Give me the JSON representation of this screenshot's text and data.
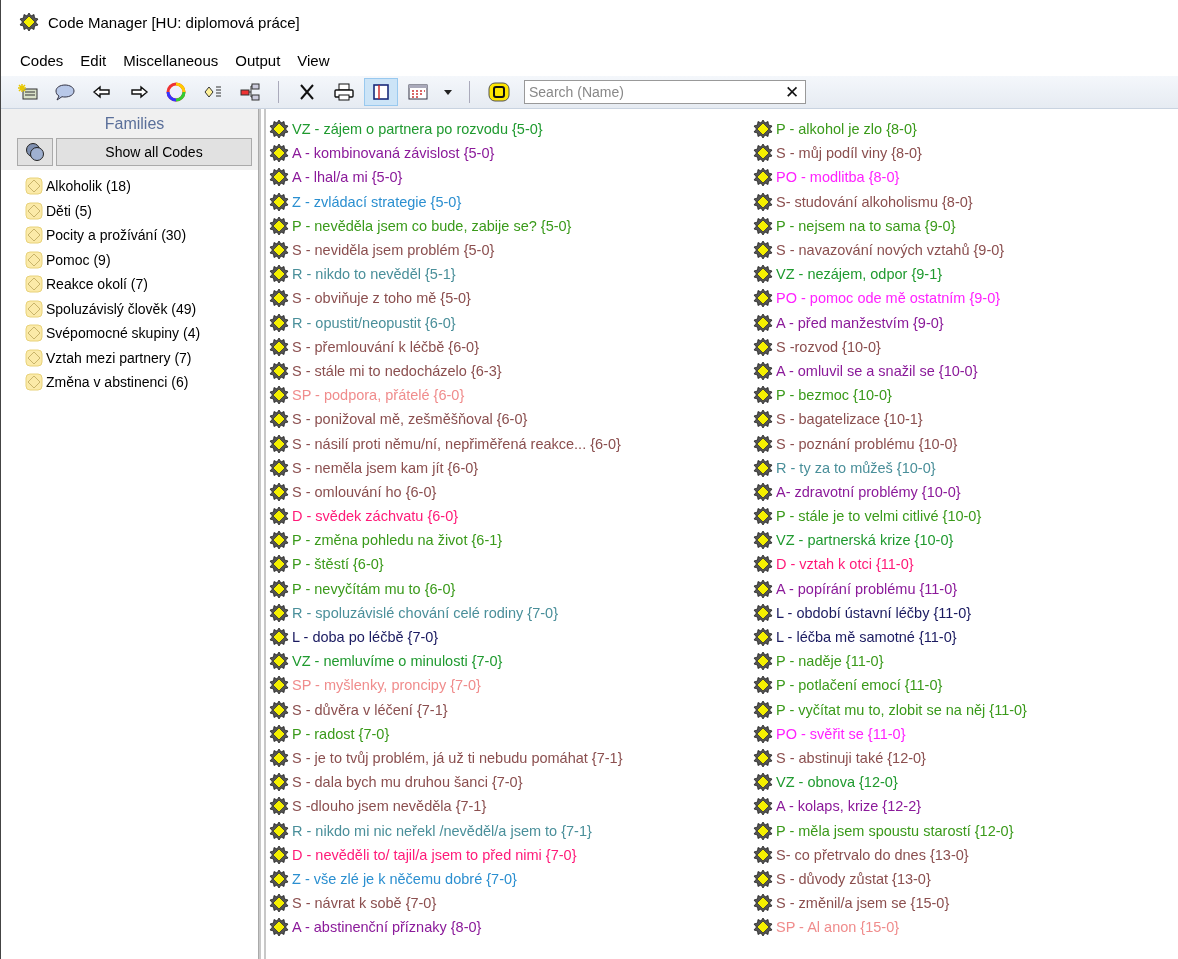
{
  "window": {
    "title": "Code Manager [HU: diplomová práce]"
  },
  "menu": [
    "Codes",
    "Edit",
    "Miscellaneous",
    "Output",
    "View"
  ],
  "toolbar": [
    {
      "kind": "new-code",
      "pressed": false
    },
    {
      "kind": "comment",
      "pressed": false
    },
    {
      "kind": "back",
      "pressed": false
    },
    {
      "kind": "forward",
      "pressed": false
    },
    {
      "kind": "colors",
      "pressed": false
    },
    {
      "kind": "list",
      "pressed": false
    },
    {
      "kind": "tree",
      "pressed": false
    },
    {
      "kind": "separator"
    },
    {
      "kind": "delete",
      "pressed": false
    },
    {
      "kind": "print",
      "pressed": false
    },
    {
      "kind": "split",
      "pressed": true
    },
    {
      "kind": "grid",
      "pressed": false
    },
    {
      "kind": "dropdown",
      "pressed": false
    },
    {
      "kind": "separator"
    },
    {
      "kind": "filter",
      "pressed": false
    }
  ],
  "search": {
    "placeholder": "Search (Name)",
    "clear": "✕"
  },
  "families": {
    "title": "Families",
    "show_all": "Show all Codes",
    "items": [
      "Alkoholik (18)",
      "Děti (5)",
      "Pocity a prožívání (30)",
      "Pomoc (9)",
      "Reakce okolí (7)",
      "Spoluzávislý člověk (49)",
      "Svépomocné skupiny (4)",
      "Vztah mezi partnery (7)",
      "Změna v abstinenci (6)"
    ]
  },
  "codes": [
    {
      "label": "VZ - zájem o partnera po rozvodu {5-0}",
      "color": "#1f9a2f"
    },
    {
      "label": "A - kombinovaná závislost {5-0}",
      "color": "#8b1a9a"
    },
    {
      "label": "A - lhal/a mi {5-0}",
      "color": "#8b1a9a"
    },
    {
      "label": "Z - zvládací strategie {5-0}",
      "color": "#2b8fd0"
    },
    {
      "label": "P - nevěděla jsem co bude, zabije se? {5-0}",
      "color": "#3a9a1a"
    },
    {
      "label": "S - neviděla jsem problém {5-0}",
      "color": "#8b4f4f"
    },
    {
      "label": "R - nikdo to nevěděl {5-1}",
      "color": "#4a8f9a"
    },
    {
      "label": "S - obviňuje z toho mě {5-0}",
      "color": "#8b4f4f"
    },
    {
      "label": "R - opustit/neopustit {6-0}",
      "color": "#4a8f9a"
    },
    {
      "label": "S - přemlouvání k léčbě {6-0}",
      "color": "#8b4f4f"
    },
    {
      "label": "S - stále mi to nedocházelo {6-3}",
      "color": "#8b4f4f"
    },
    {
      "label": "SP - podpora, přátelé {6-0}",
      "color": "#f08c8c"
    },
    {
      "label": "S - ponižoval mě, zešměšňoval {6-0}",
      "color": "#8b4f4f"
    },
    {
      "label": "S - násilí proti němu/ní, nepřiměřená reakce... {6-0}",
      "color": "#8b4f4f"
    },
    {
      "label": "S - neměla jsem kam jít {6-0}",
      "color": "#8b4f4f"
    },
    {
      "label": "S - omlouvání ho {6-0}",
      "color": "#8b4f4f"
    },
    {
      "label": "D - svědek záchvatu {6-0}",
      "color": "#ff1a78"
    },
    {
      "label": "P - změna pohledu na život {6-1}",
      "color": "#3a9a1a"
    },
    {
      "label": "P - štěstí {6-0}",
      "color": "#3a9a1a"
    },
    {
      "label": "P - nevyčítám mu to {6-0}",
      "color": "#3a9a1a"
    },
    {
      "label": "R - spoluzávislé chování celé rodiny {7-0}",
      "color": "#4a8f9a"
    },
    {
      "label": "L - doba po léčbě {7-0}",
      "color": "#1a1a60"
    },
    {
      "label": "VZ - nemluvíme o minulosti {7-0}",
      "color": "#1f9a2f"
    },
    {
      "label": "SP - myšlenky, proncipy {7-0}",
      "color": "#f08c8c"
    },
    {
      "label": "S - důvěra v léčení {7-1}",
      "color": "#8b4f4f"
    },
    {
      "label": "P - radost {7-0}",
      "color": "#3a9a1a"
    },
    {
      "label": "S - je to tvůj problém, já už ti nebudu pomáhat {7-1}",
      "color": "#8b4f4f"
    },
    {
      "label": "S - dala bych mu druhou šanci {7-0}",
      "color": "#8b4f4f"
    },
    {
      "label": "S -dlouho jsem nevěděla {7-1}",
      "color": "#8b4f4f"
    },
    {
      "label": "R - nikdo mi nic neřekl /nevěděl/a jsem to {7-1}",
      "color": "#4a8f9a"
    },
    {
      "label": "D - nevěděli to/ tajil/a jsem to před nimi {7-0}",
      "color": "#ff1a78"
    },
    {
      "label": "Z - vše zlé je k něčemu dobré {7-0}",
      "color": "#2b8fd0"
    },
    {
      "label": "S - návrat k sobě {7-0}",
      "color": "#8b4f4f"
    },
    {
      "label": "A - abstinenční příznaky {8-0}",
      "color": "#8b1a9a"
    },
    {
      "label": "P - alkohol je zlo {8-0}",
      "color": "#3a9a1a"
    },
    {
      "label": "S - můj podíl viny {8-0}",
      "color": "#8b4f4f"
    },
    {
      "label": "PO - modlitba {8-0}",
      "color": "#ff22ff"
    },
    {
      "label": "S- studování alkoholismu {8-0}",
      "color": "#8b4f4f"
    },
    {
      "label": "P - nejsem na to sama {9-0}",
      "color": "#3a9a1a"
    },
    {
      "label": "S - navazování nových vztahů {9-0}",
      "color": "#8b4f4f"
    },
    {
      "label": "VZ - nezájem, odpor {9-1}",
      "color": "#1f9a2f"
    },
    {
      "label": "PO - pomoc ode mě ostatním {9-0}",
      "color": "#ff22ff"
    },
    {
      "label": "A - před manžestvím {9-0}",
      "color": "#8b1a9a"
    },
    {
      "label": "S -rozvod {10-0}",
      "color": "#8b4f4f"
    },
    {
      "label": "A - omluvil se a snažil se {10-0}",
      "color": "#8b1a9a"
    },
    {
      "label": "P - bezmoc {10-0}",
      "color": "#3a9a1a"
    },
    {
      "label": "S - bagatelizace {10-1}",
      "color": "#8b4f4f"
    },
    {
      "label": "S - poznání problému {10-0}",
      "color": "#8b4f4f"
    },
    {
      "label": "R - ty za to můžeš {10-0}",
      "color": "#4a8f9a"
    },
    {
      "label": "A- zdravotní problémy {10-0}",
      "color": "#8b1a9a"
    },
    {
      "label": "P - stále je to velmi citlivé {10-0}",
      "color": "#3a9a1a"
    },
    {
      "label": "VZ - partnerská krize {10-0}",
      "color": "#1f9a2f"
    },
    {
      "label": "D - vztah k otci {11-0}",
      "color": "#ff1a78"
    },
    {
      "label": "A - popírání problému {11-0}",
      "color": "#8b1a9a"
    },
    {
      "label": "L - období ústavní léčby {11-0}",
      "color": "#1a1a60"
    },
    {
      "label": "L - léčba mě samotné {11-0}",
      "color": "#1a1a60"
    },
    {
      "label": "P - naděje {11-0}",
      "color": "#3a9a1a"
    },
    {
      "label": "P - potlačení emocí {11-0}",
      "color": "#3a9a1a"
    },
    {
      "label": "P - vyčítat mu to, zlobit se na něj {11-0}",
      "color": "#3a9a1a"
    },
    {
      "label": "PO - svěřit se {11-0}",
      "color": "#ff22ff"
    },
    {
      "label": "S - abstinuji také {12-0}",
      "color": "#8b4f4f"
    },
    {
      "label": "VZ - obnova {12-0}",
      "color": "#1f9a2f"
    },
    {
      "label": "A - kolaps, krize {12-2}",
      "color": "#8b1a9a"
    },
    {
      "label": "P - měla jsem spoustu starostí {12-0}",
      "color": "#3a9a1a"
    },
    {
      "label": "S- co přetrvalo do dnes {13-0}",
      "color": "#8b4f4f"
    },
    {
      "label": "S - důvody zůstat {13-0}",
      "color": "#8b4f4f"
    },
    {
      "label": "S - změnil/a jsem se {15-0}",
      "color": "#8b4f4f"
    },
    {
      "label": "SP - Al anon {15-0}",
      "color": "#f08c8c"
    }
  ]
}
